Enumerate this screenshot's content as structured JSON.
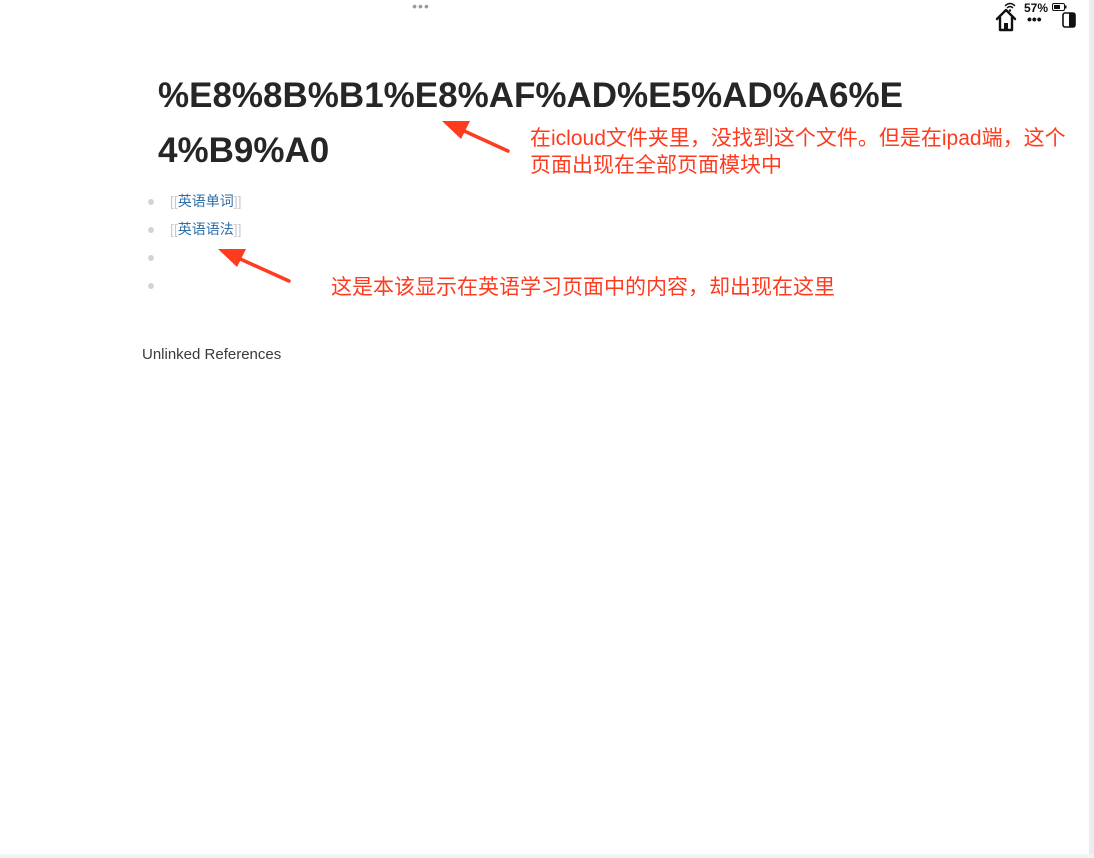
{
  "topbar": {
    "more_dots": "•••"
  },
  "status_bar": {
    "battery": "57%",
    "more_dots": "•••"
  },
  "page": {
    "title": "%E8%8B%B1%E8%AF%AD%E5%AD%A6%E4%B9%A0",
    "blocks": [
      {
        "open": "[[",
        "ref": "英语单词",
        "close": "]]"
      },
      {
        "open": "[[",
        "ref": "英语语法",
        "close": "]]"
      },
      {
        "text": ""
      },
      {
        "text": ""
      }
    ],
    "unlinked_references_label": "Unlinked References"
  },
  "annotations": {
    "note1": "在icloud文件夹里，没找到这个文件。但是在ipad端，这个页面出现在全部页面模块中",
    "note2": "这是本该显示在英语学习页面中的内容，却出现在这里",
    "color": "#ff3b1f"
  },
  "colors": {
    "page_ref": "#2e6fa8",
    "bracket": "#c9c9c9",
    "title": "#262626"
  }
}
